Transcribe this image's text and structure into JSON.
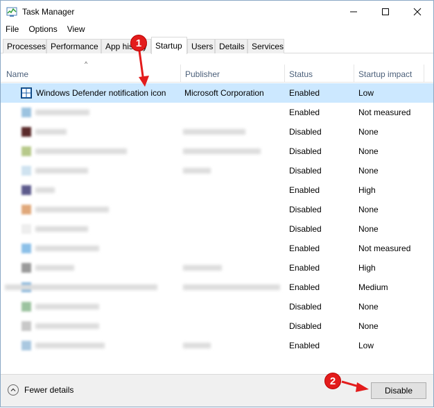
{
  "window": {
    "title": "Task Manager"
  },
  "menu": {
    "file": "File",
    "options": "Options",
    "view": "View"
  },
  "tabs": [
    {
      "label": "Processes"
    },
    {
      "label": "Performance"
    },
    {
      "label": "App history"
    },
    {
      "label": "Startup"
    },
    {
      "label": "Users"
    },
    {
      "label": "Details"
    },
    {
      "label": "Services"
    }
  ],
  "columns": {
    "name": "Name",
    "publisher": "Publisher",
    "status": "Status",
    "impact": "Startup impact"
  },
  "rows": [
    {
      "name": "Windows Defender notification icon",
      "publisher": "Microsoft Corporation",
      "status": "Enabled",
      "impact": "Low"
    },
    {
      "name": "",
      "publisher": "",
      "status": "Enabled",
      "impact": "Not measured"
    },
    {
      "name": "",
      "publisher": "",
      "status": "Disabled",
      "impact": "None"
    },
    {
      "name": "",
      "publisher": "",
      "status": "Disabled",
      "impact": "None"
    },
    {
      "name": "",
      "publisher": "",
      "status": "Disabled",
      "impact": "None"
    },
    {
      "name": "",
      "publisher": "",
      "status": "Enabled",
      "impact": "High"
    },
    {
      "name": "",
      "publisher": "",
      "status": "Disabled",
      "impact": "None"
    },
    {
      "name": "",
      "publisher": "",
      "status": "Disabled",
      "impact": "None"
    },
    {
      "name": "",
      "publisher": "",
      "status": "Enabled",
      "impact": "Not measured"
    },
    {
      "name": "",
      "publisher": "",
      "status": "Enabled",
      "impact": "High"
    },
    {
      "name": "",
      "publisher": "",
      "status": "Enabled",
      "impact": "Medium"
    },
    {
      "name": "",
      "publisher": "",
      "status": "Disabled",
      "impact": "None"
    },
    {
      "name": "",
      "publisher": "",
      "status": "Disabled",
      "impact": "None"
    },
    {
      "name": "",
      "publisher": "",
      "status": "Enabled",
      "impact": "Low"
    }
  ],
  "footer": {
    "fewer_details": "Fewer details",
    "disable": "Disable"
  },
  "annotations": {
    "badge1": "1",
    "badge2": "2"
  },
  "colors": {
    "selection": "#cce8ff",
    "annotation": "#e31c1c"
  }
}
